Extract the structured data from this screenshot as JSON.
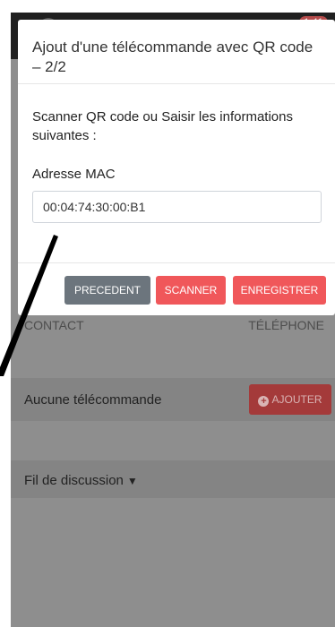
{
  "status_bar": {
    "badge": "1:41"
  },
  "modal": {
    "title": "Ajout d'une télécommande avec QR code – 2/2",
    "instructions": "Scanner QR code ou Saisir les informations suivantes :",
    "mac_label": "Adresse MAC",
    "mac_value": "00:04:74:30:00:B1",
    "buttons": {
      "previous": "PRECEDENT",
      "scan": "SCANNER",
      "save": "ENREGISTRER"
    }
  },
  "background": {
    "columns": {
      "contact": "CONTACT",
      "telephone": "TÉLÉPHONE"
    },
    "remotes_empty": "Aucune télécommande",
    "add_button": "AJOUTER",
    "thread_label": "Fil de discussion"
  },
  "colors": {
    "primary_red": "#f0575a",
    "secondary_gray": "#6c757d",
    "overlay": "#8e8e8e"
  },
  "icons": {
    "add": "plus-circle-icon",
    "thread_toggle": "chevron-down-icon"
  }
}
